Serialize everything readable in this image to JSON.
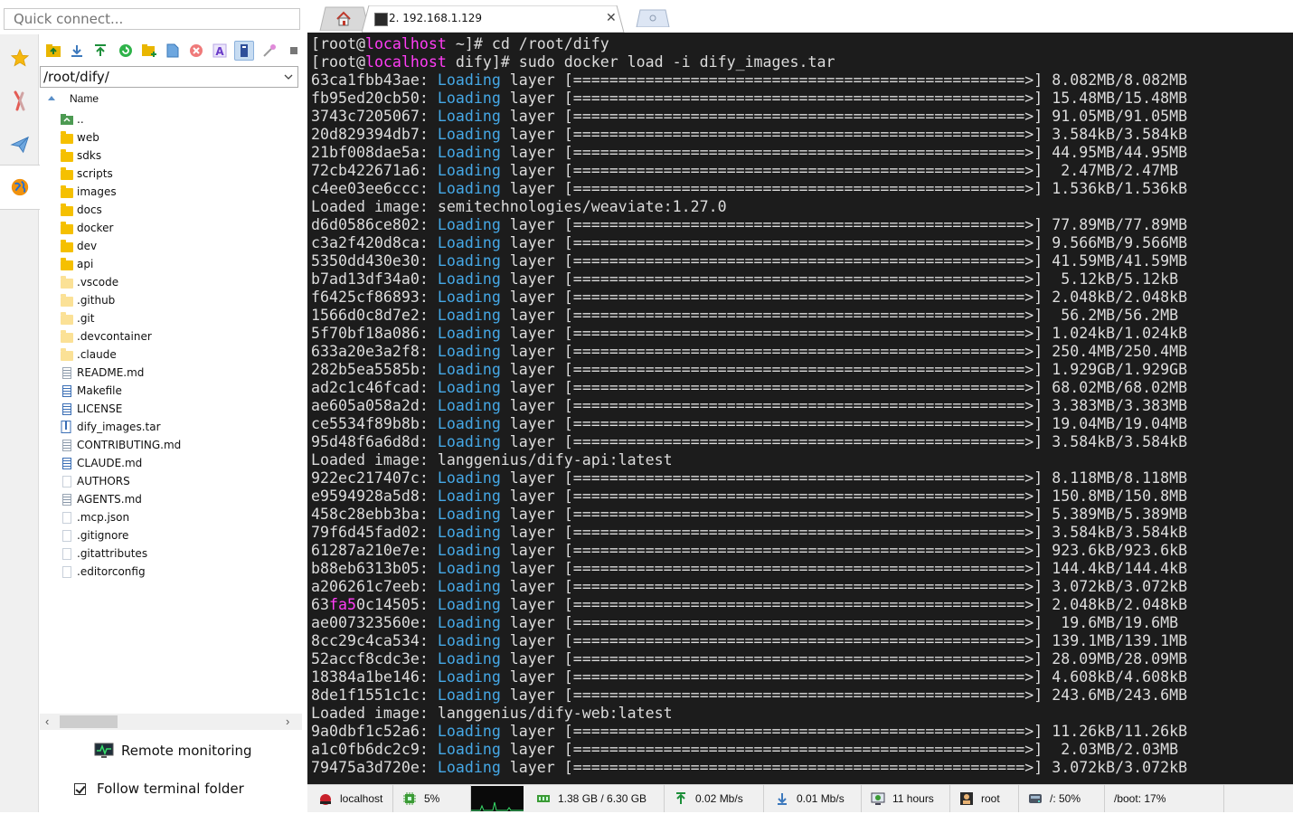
{
  "quick_connect": {
    "placeholder": "Quick connect..."
  },
  "sidebar_tabs": [
    "favorites-star",
    "tools",
    "sftp-send",
    "sessions-globe"
  ],
  "sftp": {
    "path": "/root/dify/",
    "column_name": "Name",
    "files": [
      {
        "name": "..",
        "type": "up"
      },
      {
        "name": "web",
        "type": "folder"
      },
      {
        "name": "sdks",
        "type": "folder"
      },
      {
        "name": "scripts",
        "type": "folder"
      },
      {
        "name": "images",
        "type": "folder"
      },
      {
        "name": "docs",
        "type": "folder"
      },
      {
        "name": "docker",
        "type": "folder"
      },
      {
        "name": "dev",
        "type": "folder"
      },
      {
        "name": "api",
        "type": "folder"
      },
      {
        "name": ".vscode",
        "type": "hidden-folder"
      },
      {
        "name": ".github",
        "type": "hidden-folder"
      },
      {
        "name": ".git",
        "type": "hidden-folder"
      },
      {
        "name": ".devcontainer",
        "type": "hidden-folder"
      },
      {
        "name": ".claude",
        "type": "hidden-folder"
      },
      {
        "name": "README.md",
        "type": "md"
      },
      {
        "name": "Makefile",
        "type": "blue"
      },
      {
        "name": "LICENSE",
        "type": "blue"
      },
      {
        "name": "dify_images.tar",
        "type": "archive"
      },
      {
        "name": "CONTRIBUTING.md",
        "type": "md"
      },
      {
        "name": "CLAUDE.md",
        "type": "blue"
      },
      {
        "name": "AUTHORS",
        "type": "blank"
      },
      {
        "name": "AGENTS.md",
        "type": "md"
      },
      {
        "name": ".mcp.json",
        "type": "blank"
      },
      {
        "name": ".gitignore",
        "type": "blank"
      },
      {
        "name": ".gitattributes",
        "type": "blank"
      },
      {
        "name": ".editorconfig",
        "type": "blank"
      }
    ],
    "remote_monitoring": "Remote monitoring",
    "follow_terminal_folder": "Follow terminal folder"
  },
  "tabs": {
    "terminal_tab_label": "2. 192.168.1.129"
  },
  "terminal": {
    "lines": [
      {
        "kind": "prompt",
        "user": "[root@",
        "host": "localhost",
        "rest": " ~]# cd /root/dify"
      },
      {
        "kind": "prompt",
        "user": "[root@",
        "host": "localhost",
        "rest": " dify]# sudo docker load -i dify_images.tar"
      },
      {
        "kind": "layer",
        "id": "63ca1fbb43ae",
        "size": " 8.082MB/8.082MB"
      },
      {
        "kind": "layer",
        "id": "fb95ed20cb50",
        "size": " 15.48MB/15.48MB"
      },
      {
        "kind": "layer",
        "id": "3743c7205067",
        "size": " 91.05MB/91.05MB"
      },
      {
        "kind": "layer",
        "id": "20d829394db7",
        "size": " 3.584kB/3.584kB"
      },
      {
        "kind": "layer",
        "id": "21bf008dae5a",
        "size": " 44.95MB/44.95MB"
      },
      {
        "kind": "layer",
        "id": "72cb422671a6",
        "size": "  2.47MB/2.47MB"
      },
      {
        "kind": "layer",
        "id": "c4ee03ee6ccc",
        "size": " 1.536kB/1.536kB"
      },
      {
        "kind": "loaded",
        "text": "Loaded image: semitechnologies/weaviate:1.27.0"
      },
      {
        "kind": "layer",
        "id": "d6d0586ce802",
        "size": " 77.89MB/77.89MB"
      },
      {
        "kind": "layer",
        "id": "c3a2f420d8ca",
        "size": " 9.566MB/9.566MB"
      },
      {
        "kind": "layer",
        "id": "5350dd430e30",
        "size": " 41.59MB/41.59MB"
      },
      {
        "kind": "layer",
        "id": "b7ad13df34a0",
        "size": "  5.12kB/5.12kB"
      },
      {
        "kind": "layer",
        "id": "f6425cf86893",
        "size": " 2.048kB/2.048kB"
      },
      {
        "kind": "layer",
        "id": "1566d0c8d7e2",
        "size": "  56.2MB/56.2MB"
      },
      {
        "kind": "layer",
        "id": "5f70bf18a086",
        "size": " 1.024kB/1.024kB"
      },
      {
        "kind": "layer",
        "id": "633a20e3a2f8",
        "size": " 250.4MB/250.4MB"
      },
      {
        "kind": "layer",
        "id": "282b5ea5585b",
        "size": " 1.929GB/1.929GB"
      },
      {
        "kind": "layer",
        "id": "ad2c1c46fcad",
        "size": " 68.02MB/68.02MB"
      },
      {
        "kind": "layer",
        "id": "ae605a058a2d",
        "size": " 3.383MB/3.383MB"
      },
      {
        "kind": "layer",
        "id": "ce5534f89b8b",
        "size": " 19.04MB/19.04MB"
      },
      {
        "kind": "layer",
        "id": "95d48f6a6d8d",
        "size": " 3.584kB/3.584kB"
      },
      {
        "kind": "loaded",
        "text": "Loaded image: langgenius/dify-api:latest"
      },
      {
        "kind": "layer",
        "id": "922ec217407c",
        "size": " 8.118MB/8.118MB"
      },
      {
        "kind": "layer",
        "id": "e9594928a5d8",
        "size": " 150.8MB/150.8MB"
      },
      {
        "kind": "layer",
        "id": "458c28ebb3ba",
        "size": " 5.389MB/5.389MB"
      },
      {
        "kind": "layer",
        "id": "79f6d45fad02",
        "size": " 3.584kB/3.584kB"
      },
      {
        "kind": "layer",
        "id": "61287a210e7e",
        "size": " 923.6kB/923.6kB"
      },
      {
        "kind": "layer",
        "id": "b88eb6313b05",
        "size": " 144.4kB/144.4kB"
      },
      {
        "kind": "layer",
        "id": "a206261c7eeb",
        "size": " 3.072kB/3.072kB"
      },
      {
        "kind": "layer",
        "id": "63fa50c14505",
        "hl": "fa5",
        "size": " 2.048kB/2.048kB"
      },
      {
        "kind": "layer",
        "id": "ae007323560e",
        "size": "  19.6MB/19.6MB"
      },
      {
        "kind": "layer",
        "id": "8cc29c4ca534",
        "size": " 139.1MB/139.1MB"
      },
      {
        "kind": "layer",
        "id": "52accf8cdc3e",
        "size": " 28.09MB/28.09MB"
      },
      {
        "kind": "layer",
        "id": "18384a1be146",
        "size": " 4.608kB/4.608kB"
      },
      {
        "kind": "layer",
        "id": "8de1f1551c1c",
        "size": " 243.6MB/243.6MB"
      },
      {
        "kind": "loaded",
        "text": "Loaded image: langgenius/dify-web:latest"
      },
      {
        "kind": "layer",
        "id": "9a0dbf1c52a6",
        "size": " 11.26kB/11.26kB"
      },
      {
        "kind": "layer",
        "id": "a1c0fb6dc2c9",
        "size": "  2.03MB/2.03MB"
      },
      {
        "kind": "layer",
        "id": "79475a3d720e",
        "size": " 3.072kB/3.072kB"
      }
    ],
    "loading_word": "Loading",
    "layer_word": " layer ",
    "progress_bar": "[==================================================>]"
  },
  "status": {
    "host": "localhost",
    "cpu": "5%",
    "memory": "1.38 GB / 6.30 GB",
    "upload": "0.02 Mb/s",
    "download": "0.01 Mb/s",
    "uptime": "11 hours",
    "user": "root",
    "disk": "/: 50%",
    "boot": "/boot: 17%"
  },
  "colors": {
    "terminal_bg": "#1c1c1c",
    "host": "#ff3df5",
    "loading": "#45a8e6",
    "folder": "#f5c000"
  }
}
